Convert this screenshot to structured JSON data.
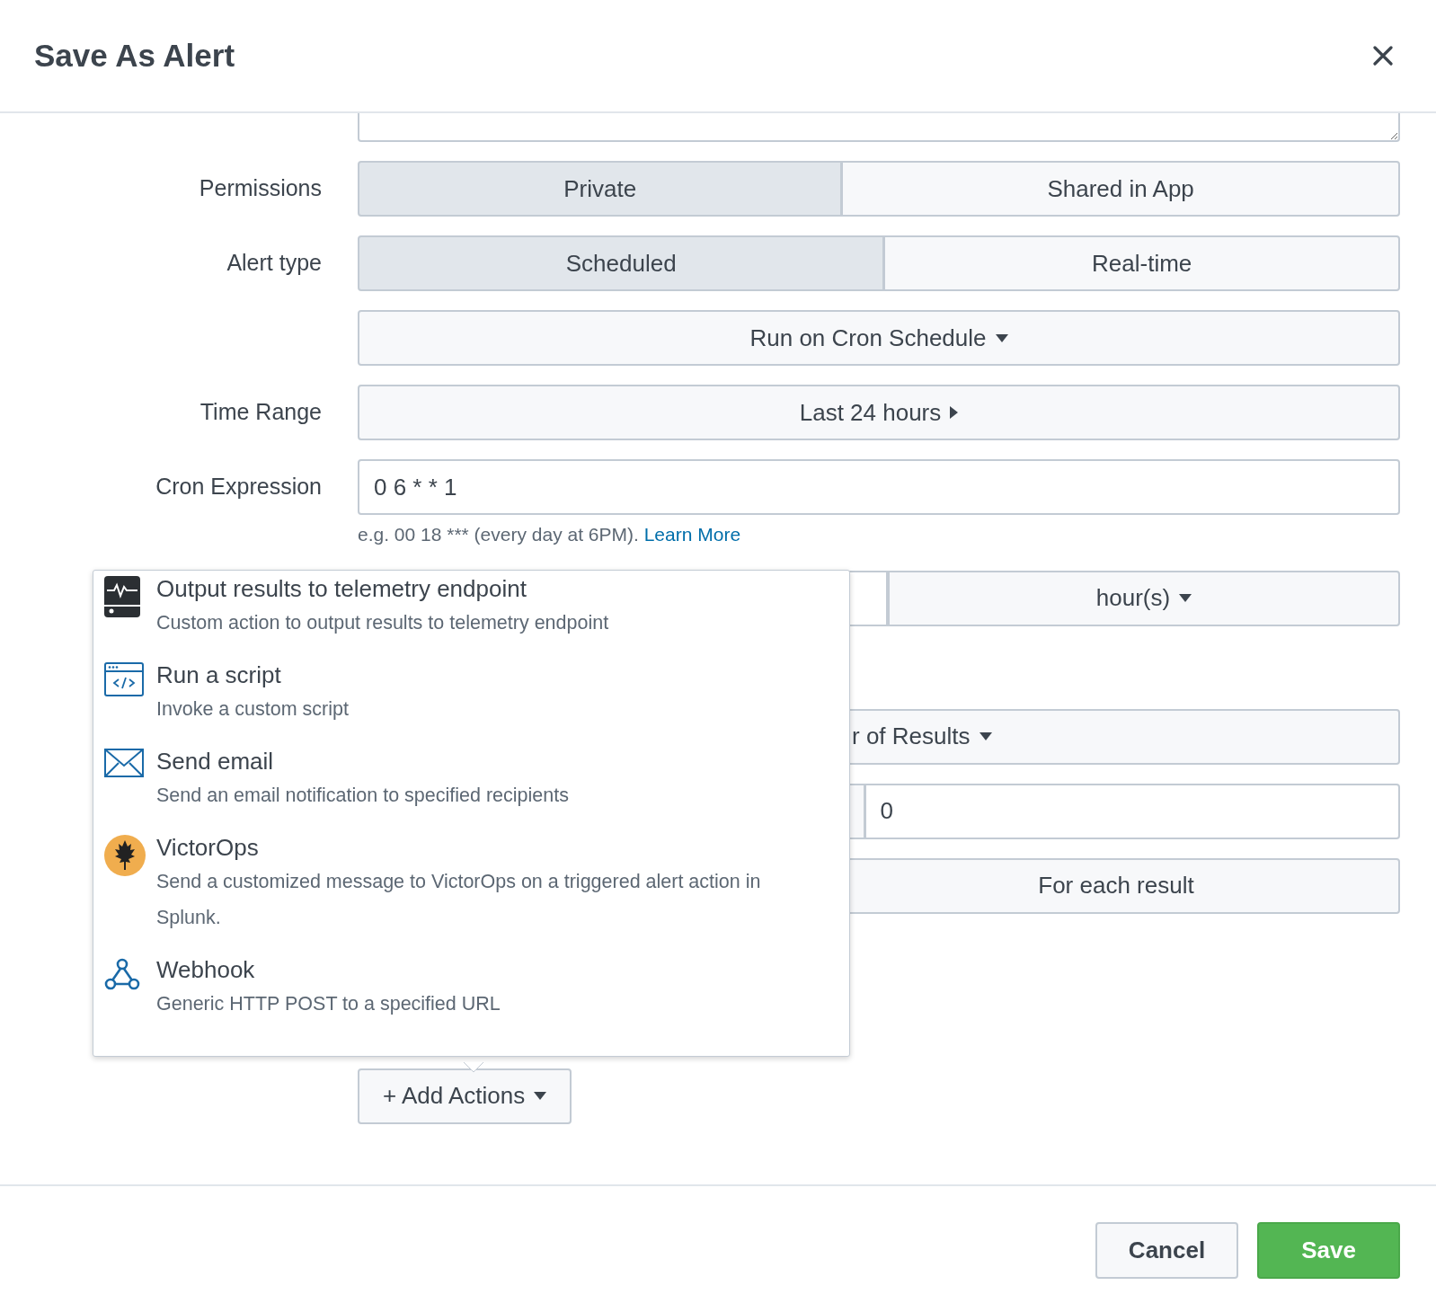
{
  "dialog": {
    "title": "Save As Alert"
  },
  "fields": [
    {
      "kind": "textarea"
    },
    {
      "kind": "segmented",
      "label": "Permissions",
      "options": [
        {
          "label": "Private",
          "selected": true
        },
        {
          "label": "Shared in App",
          "selected": false
        }
      ]
    },
    {
      "kind": "segmented",
      "label": "Alert type",
      "options": [
        {
          "label": "Scheduled",
          "selected": true
        },
        {
          "label": "Real-time",
          "selected": false
        }
      ]
    },
    {
      "kind": "dropdown",
      "value": "Run on Cron Schedule"
    },
    {
      "kind": "submenu",
      "label": "Time Range",
      "value": "Last 24 hours"
    },
    {
      "kind": "input",
      "label": "Cron Expression",
      "value": "0 6 * * 1",
      "help": "e.g. 00 18 *** (every day at 6PM).",
      "help_link": "Learn More"
    },
    {
      "kind": "split-dropdown",
      "value": "hour(s)"
    },
    {
      "kind": "partial-dropdown",
      "value": "r of Results"
    },
    {
      "kind": "split-input",
      "value": "0"
    },
    {
      "kind": "split-button",
      "value": "For each result"
    }
  ],
  "actions_menu": {
    "items": [
      {
        "kind": "telemetry",
        "title": "Output results to telemetry endpoint",
        "description": "Custom action to output results to telemetry endpoint"
      },
      {
        "kind": "script",
        "title": "Run a script",
        "description": "Invoke a custom script"
      },
      {
        "kind": "email",
        "title": "Send email",
        "description": "Send an email notification to specified recipients"
      },
      {
        "kind": "victorops",
        "title": "VictorOps",
        "description": "Send a customized message to VictorOps on a triggered alert action in Splunk."
      },
      {
        "kind": "webhook",
        "title": "Webhook",
        "description": "Generic HTTP POST to a specified URL"
      }
    ]
  },
  "add_actions": {
    "label": "+ Add Actions"
  },
  "footer": {
    "buttons": [
      {
        "label": "Cancel",
        "kind": "secondary"
      },
      {
        "label": "Save",
        "kind": "primary"
      }
    ]
  }
}
